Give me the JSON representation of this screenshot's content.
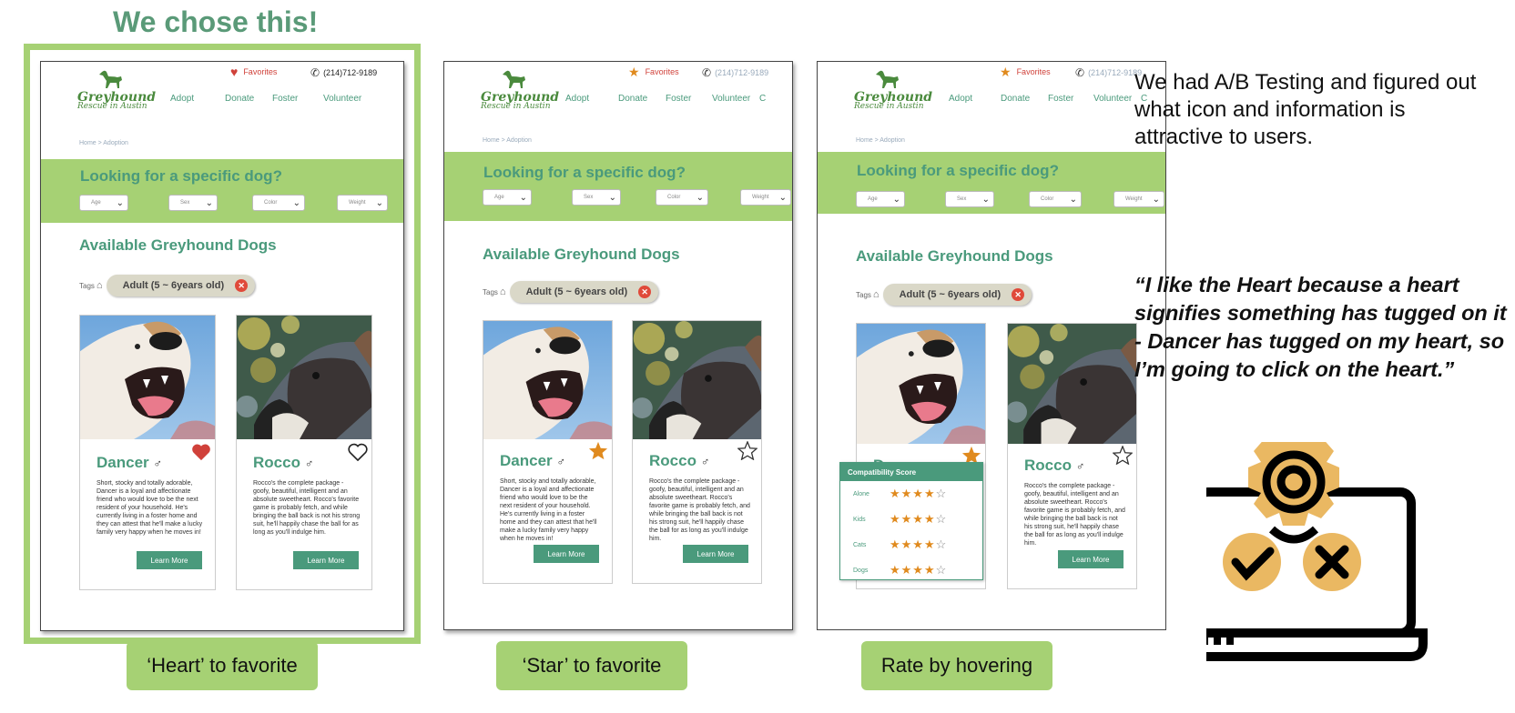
{
  "headline": "We chose this!",
  "pills": [
    "‘Heart’ to favorite",
    "‘Star’ to favorite",
    "Rate by hovering"
  ],
  "note": "We had A/B Testing and figured out what icon and information is attractive to users.",
  "quote": "“I like the Heart because a heart signifies something has tugged on it - Dancer has tugged on my heart, so I’m going to click on the heart.”",
  "site": {
    "favorites_label": "Favorites",
    "phone": "(214)712-9189",
    "logo_title": "Greyhound",
    "logo_sub": "Rescue in Austin",
    "nav": [
      "Adopt",
      "Donate",
      "Foster",
      "Volunteer"
    ],
    "breadcrumb": "Home > Adoption",
    "search_title": "Looking for a specific dog?",
    "filters": [
      "Age",
      "Sex",
      "Color",
      "Weight"
    ],
    "available_title": "Available Greyhound Dogs",
    "tags_label": "Tags",
    "tag_chip": "Adult (5 ~ 6years old)",
    "learn_more": "Learn More"
  },
  "dogs": [
    {
      "name": "Dancer",
      "gender": "♂",
      "desc": "Short, stocky and totally adorable, Dancer is a loyal and affectionate friend who would love to be the next resident of your household. He's currently living in a foster home and they can attest that he'll make a lucky family very happy when he moves in!"
    },
    {
      "name": "Rocco",
      "gender": "♂",
      "desc": "Rocco's the complete package - goofy, beautiful, intelligent and an absolute sweetheart. Rocco's favorite game is probably fetch, and while bringing the ball back is not his strong suit, he'll happily chase the ball for as long as you'll indulge him."
    }
  ],
  "compat": {
    "title": "Compatibility Score",
    "rows": [
      {
        "label": "Alone",
        "stars": 4
      },
      {
        "label": "Kids",
        "stars": 4
      },
      {
        "label": "Cats",
        "stars": 4
      },
      {
        "label": "Dogs",
        "stars": 4
      }
    ]
  },
  "colors": {
    "green_band": "#a6d174",
    "teal": "#4a9a7c",
    "heart": "#d0413a",
    "star": "#e08a1e"
  }
}
